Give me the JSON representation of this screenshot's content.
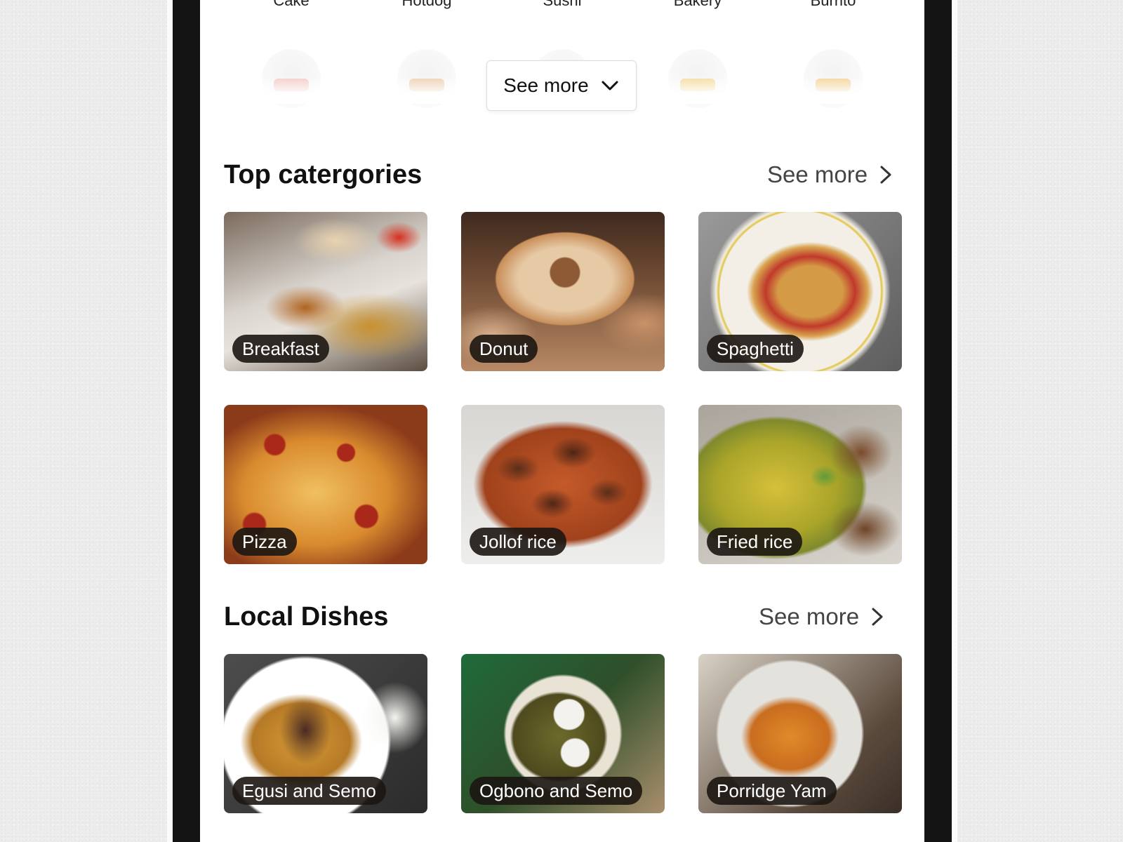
{
  "mini_categories": [
    "Cake",
    "Hotdog",
    "Sushi",
    "Bakery",
    "Burrito"
  ],
  "dropdown": {
    "label": "See more",
    "icon": "chevron-down-icon"
  },
  "top_categories": {
    "title": "Top catergories",
    "see_more": "See more",
    "items": [
      "Breakfast",
      "Donut",
      "Spaghetti",
      "Pizza",
      "Jollof rice",
      "Fried rice"
    ]
  },
  "local_dishes": {
    "title": "Local Dishes",
    "see_more": "See more",
    "items": [
      "Egusi and Semo",
      "Ogbono and Semo",
      "Porridge Yam"
    ]
  },
  "colors": {
    "pill_background": "#1c1612",
    "bezel": "#141414",
    "screen": "#ffffff"
  }
}
